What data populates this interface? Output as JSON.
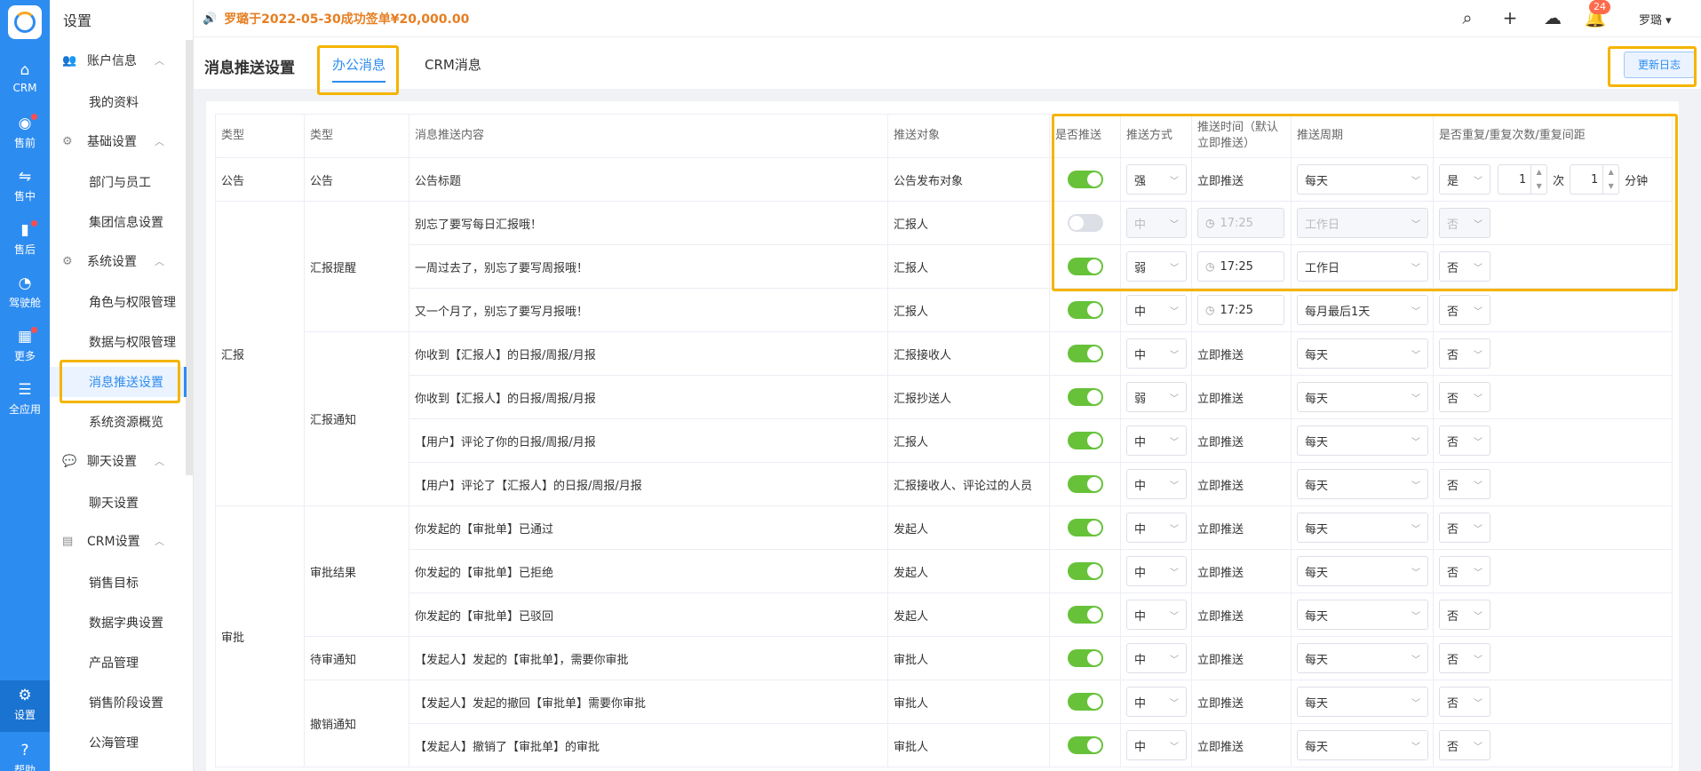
{
  "rail": {
    "items": [
      {
        "label": "CRM",
        "icon": "home-icon"
      },
      {
        "label": "售前",
        "icon": "pin-icon"
      },
      {
        "label": "售中",
        "icon": "handshake-icon"
      },
      {
        "label": "售后",
        "icon": "wrench-icon"
      },
      {
        "label": "驾驶舱",
        "icon": "dashboard-icon"
      },
      {
        "label": "更多",
        "icon": "grid-icon"
      },
      {
        "label": "全应用",
        "icon": "menu-icon"
      },
      {
        "label": "设置",
        "icon": "gear-icon"
      },
      {
        "label": "帮助",
        "icon": "help-icon"
      }
    ]
  },
  "sidebar": {
    "title": "设置",
    "groups": [
      {
        "label": "账户信息"
      },
      {
        "label": "基础设置"
      },
      {
        "label": "系统设置"
      },
      {
        "label": "聊天设置"
      },
      {
        "label": "CRM设置"
      }
    ],
    "items": [
      "我的资料",
      "部门与员工",
      "集团信息设置",
      "角色与权限管理",
      "数据与权限管理",
      "消息推送设置",
      "系统资源概览",
      "聊天设置",
      "销售目标",
      "数据字典设置",
      "产品管理",
      "销售阶段设置",
      "公海管理"
    ]
  },
  "topbar": {
    "notice": "罗璐于2022-05-30成功签单¥20,000.00",
    "badge": "24",
    "user": "罗璐"
  },
  "header": {
    "title": "消息推送设置",
    "tabs": [
      "办公消息",
      "CRM消息"
    ],
    "log_button": "更新日志"
  },
  "table": {
    "headers": [
      "类型",
      "类型",
      "消息推送内容",
      "推送对象",
      "是否推送",
      "推送方式",
      "推送时间（默认立即推送）",
      "推送周期",
      "是否重复/重复次数/重复间距"
    ],
    "times_unit": "次",
    "interval_unit": "分钟",
    "rows": [
      {
        "t1": "公告",
        "t2": "公告",
        "content": "公告标题",
        "target": "公告发布对象",
        "on": true,
        "mode": "强",
        "time": "立即推送",
        "cycle": "每天",
        "repeat": "是",
        "count": "1",
        "interval": "1"
      },
      {
        "t1": "汇报",
        "t2": "汇报提醒",
        "content": "别忘了要写每日汇报哦！",
        "target": "汇报人",
        "on": false,
        "mode": "中",
        "time": "17:25",
        "cycle": "工作日",
        "repeat": "否"
      },
      {
        "content": "一周过去了，别忘了要写周报哦！",
        "target": "汇报人",
        "on": true,
        "mode": "弱",
        "time": "17:25",
        "cycle": "工作日",
        "repeat": "否"
      },
      {
        "content": "又一个月了，别忘了要写月报哦！",
        "target": "汇报人",
        "on": true,
        "mode": "中",
        "time": "17:25",
        "cycle": "每月最后1天",
        "repeat": "否"
      },
      {
        "t2": "汇报通知",
        "content": "你收到【汇报人】的日报/周报/月报",
        "target": "汇报接收人",
        "on": true,
        "mode": "中",
        "time": "立即推送",
        "cycle": "每天",
        "repeat": "否"
      },
      {
        "content": "你收到【汇报人】的日报/周报/月报",
        "target": "汇报抄送人",
        "on": true,
        "mode": "弱",
        "time": "立即推送",
        "cycle": "每天",
        "repeat": "否"
      },
      {
        "content": "【用户】评论了你的日报/周报/月报",
        "target": "汇报人",
        "on": true,
        "mode": "中",
        "time": "立即推送",
        "cycle": "每天",
        "repeat": "否"
      },
      {
        "content": "【用户】评论了【汇报人】的日报/周报/月报",
        "target": "汇报接收人、评论过的人员",
        "on": true,
        "mode": "中",
        "time": "立即推送",
        "cycle": "每天",
        "repeat": "否"
      },
      {
        "t1": "审批",
        "t2": "审批结果",
        "content": "你发起的【审批单】已通过",
        "target": "发起人",
        "on": true,
        "mode": "中",
        "time": "立即推送",
        "cycle": "每天",
        "repeat": "否"
      },
      {
        "content": "你发起的【审批单】已拒绝",
        "target": "发起人",
        "on": true,
        "mode": "中",
        "time": "立即推送",
        "cycle": "每天",
        "repeat": "否"
      },
      {
        "content": "你发起的【审批单】已驳回",
        "target": "发起人",
        "on": true,
        "mode": "中",
        "time": "立即推送",
        "cycle": "每天",
        "repeat": "否"
      },
      {
        "t2": "待审通知",
        "content": "【发起人】发起的【审批单】，需要你审批",
        "target": "审批人",
        "on": true,
        "mode": "中",
        "time": "立即推送",
        "cycle": "每天",
        "repeat": "否"
      },
      {
        "t2": "撤销通知",
        "content": "【发起人】发起的撤回【审批单】需要你审批",
        "target": "审批人",
        "on": true,
        "mode": "中",
        "time": "立即推送",
        "cycle": "每天",
        "repeat": "否"
      },
      {
        "content": "【发起人】撤销了【审批单】的审批",
        "target": "审批人",
        "on": true,
        "mode": "中",
        "time": "立即推送",
        "cycle": "每天",
        "repeat": "否"
      }
    ]
  }
}
